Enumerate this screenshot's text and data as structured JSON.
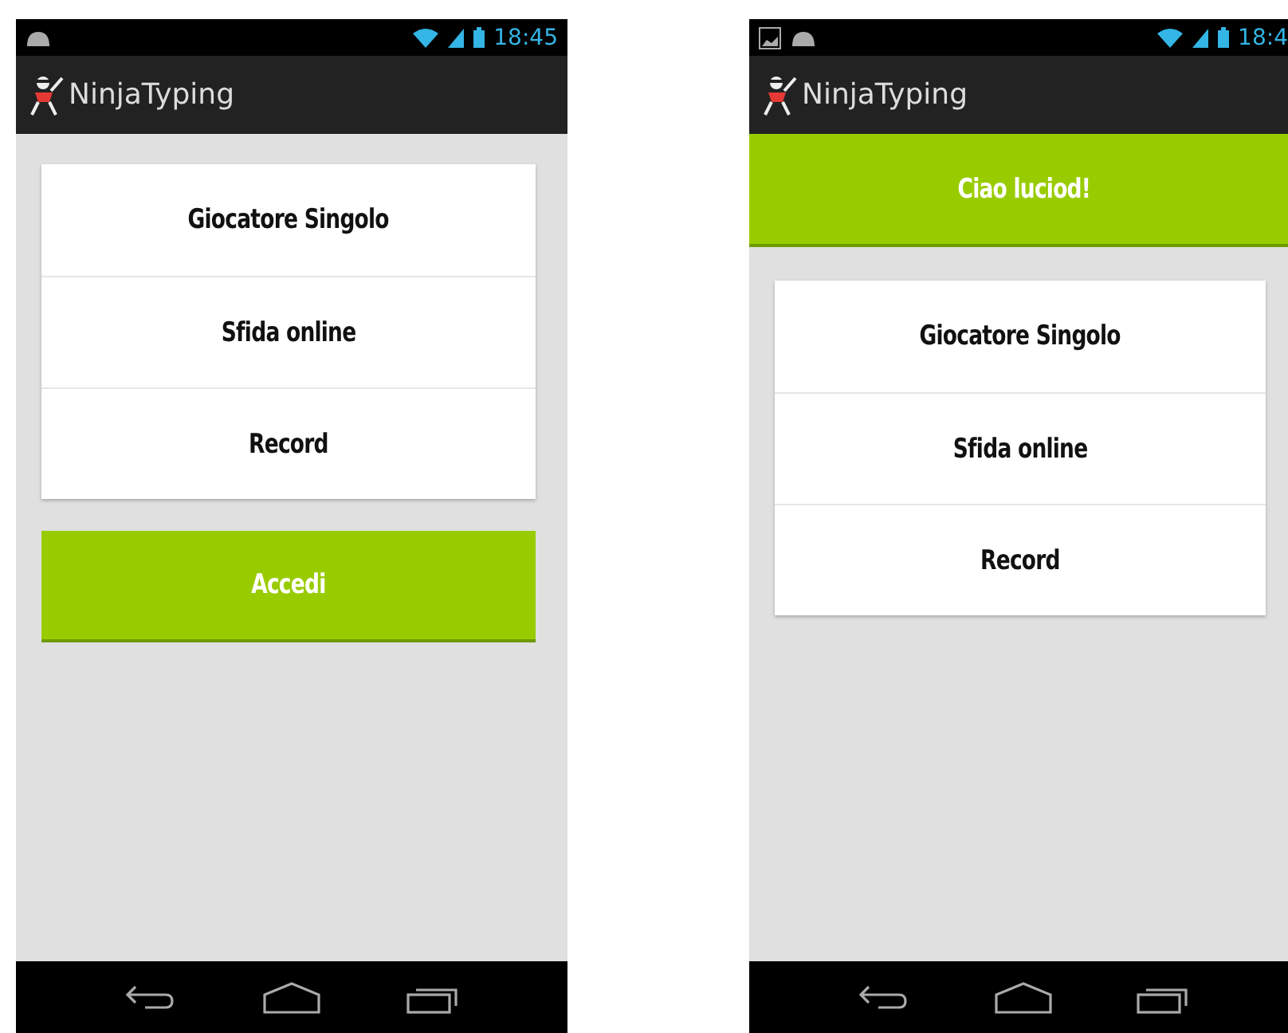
{
  "phones": [
    {
      "notifications": [
        {
          "kind": "android"
        }
      ],
      "status_time": "18:45",
      "app_title": "NinjaTyping",
      "menu": [
        "Giocatore Singolo",
        "Sfida online",
        "Record"
      ],
      "login_button": "Accedi"
    },
    {
      "notifications": [
        {
          "kind": "image"
        },
        {
          "kind": "android"
        }
      ],
      "status_time": "18:4",
      "app_title": "NinjaTyping",
      "greeting": "Ciao luciod!",
      "menu": [
        "Giocatore Singolo",
        "Sfida online",
        "Record"
      ]
    }
  ]
}
